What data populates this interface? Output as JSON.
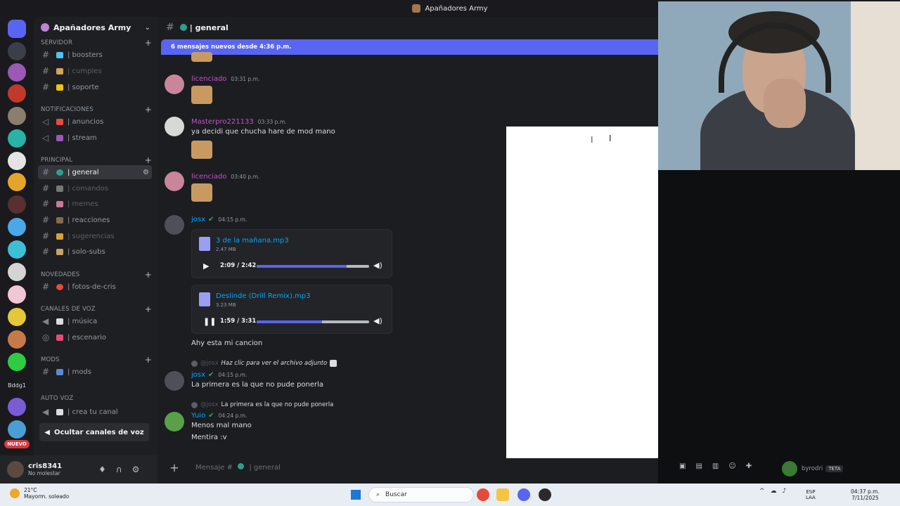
{
  "window": {
    "title": "Apañadores Army"
  },
  "servers": {
    "label": "Bddg1",
    "new_badge": "NUEVO"
  },
  "guild": {
    "name": "Apañadores Army"
  },
  "categories": [
    {
      "label": "SERVIDOR"
    },
    {
      "label": "NOTIFICACIONES"
    },
    {
      "label": "PRINCIPAL"
    },
    {
      "label": "NOVEDADES"
    },
    {
      "label": "CANALES DE VOZ"
    },
    {
      "label": "MODS"
    },
    {
      "label": "AUTO VOZ"
    }
  ],
  "channels": [
    {
      "label": "| boosters",
      "icon": "hash"
    },
    {
      "label": "| cumples",
      "icon": "hash"
    },
    {
      "label": "| soporte",
      "icon": "hash"
    },
    {
      "label": "| anuncios",
      "icon": "megaphone"
    },
    {
      "label": "| stream",
      "icon": "megaphone"
    },
    {
      "label": "| general",
      "icon": "hash"
    },
    {
      "label": "| comandos",
      "icon": "hash"
    },
    {
      "label": "| memes",
      "icon": "hash"
    },
    {
      "label": "| reacciones",
      "icon": "hash"
    },
    {
      "label": "| sugerencias",
      "icon": "hash"
    },
    {
      "label": "| solo-subs",
      "icon": "hash"
    },
    {
      "label": "| fotos-de-cris",
      "icon": "hash"
    },
    {
      "label": "| música",
      "icon": "speaker"
    },
    {
      "label": "| escenario",
      "icon": "stage"
    },
    {
      "label": "| mods",
      "icon": "hash"
    },
    {
      "label": "| crea tu canal",
      "icon": "speaker"
    }
  ],
  "hide_voice_label": "Ocultar canales de voz",
  "user": {
    "name": "cris8341",
    "status": "No molestar"
  },
  "chat": {
    "channel": "| general",
    "new_messages_banner": "6 mensajes nuevos desde 4:36 p.m.",
    "messages": [
      {
        "author": "licenciado",
        "time": "03:31 p.m.",
        "color": "#c053c8"
      },
      {
        "author": "Masterpro221133",
        "time": "03:33 p.m.",
        "text": "ya decidi que chucha hare de mod mano",
        "color": "#c053c8"
      },
      {
        "author": "licenciado",
        "time": "03:40 p.m.",
        "color": "#c053c8"
      },
      {
        "author": "josx",
        "time": "04:15 p.m.",
        "text": "Ahy esta mi cancion",
        "color": "#00a8fc"
      },
      {
        "author": "josx",
        "time": "04:15 p.m.",
        "text": "La primera es la que no pude ponerla",
        "color": "#00a8fc",
        "reply": {
          "name": "@josx",
          "text": "Haz clic para ver el archivo adjunto"
        }
      },
      {
        "author": "Yuio",
        "time": "04:24 p.m.",
        "text": "Menos mal mano",
        "text2": "Mentira :v",
        "color": "#00a8fc",
        "reply": {
          "name": "@josx",
          "text": "La primera es la que no pude ponerla"
        }
      }
    ],
    "attachments": [
      {
        "name": "3 de la mañana.mp3",
        "size": "2.47 MB",
        "time": "2:09 / 2:42",
        "progress": 0.8,
        "state": "paused"
      },
      {
        "name": "Deslinde (Drill Remix).mp3",
        "size": "3.23 MB",
        "time": "1:59 / 3:31",
        "progress": 0.58,
        "state": "playing"
      }
    ],
    "composer_placeholder": "Mensaje #",
    "composer_channel": "| general"
  },
  "stream": {
    "name": "byrodri",
    "tag": "TETA"
  },
  "taskbar": {
    "weather_temp": "21°C",
    "weather_desc": "Mayorm. soleado",
    "search": "Buscar",
    "lang_1": "ESP",
    "lang_2": "LAA",
    "time": "04:37 p.m.",
    "date": "7/11/2025"
  },
  "colors": {
    "accent": "#5865f2",
    "link": "#00a8fc",
    "mention": "#c053c8",
    "bg": "#1c1d21"
  }
}
